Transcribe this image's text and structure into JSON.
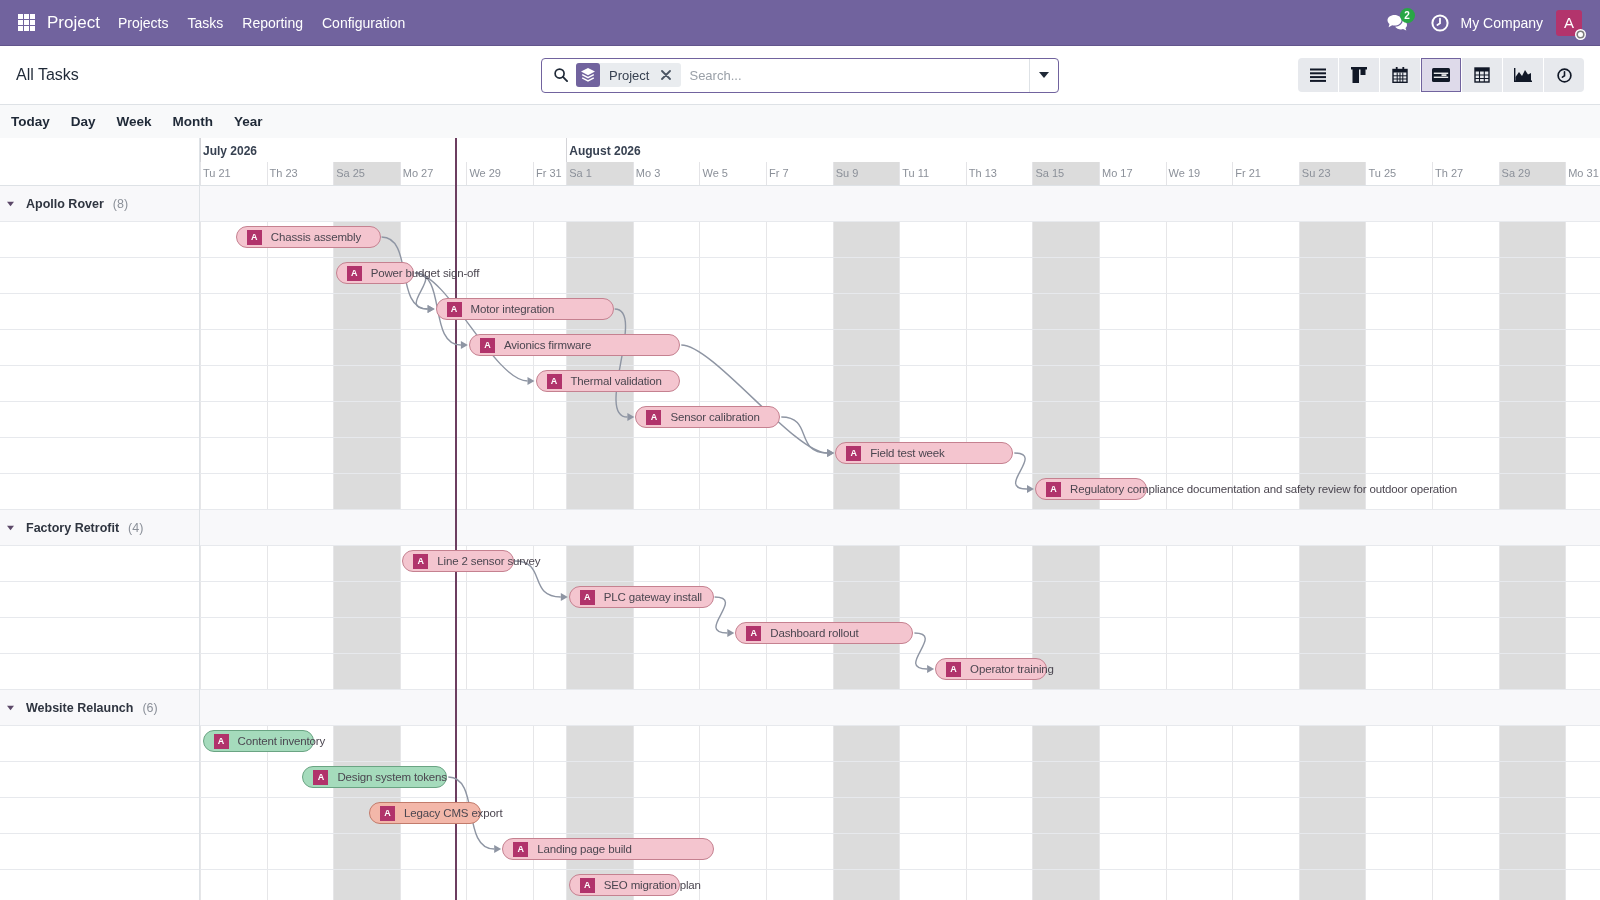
{
  "navbar": {
    "app_name": "Project",
    "menu": [
      "Projects",
      "Tasks",
      "Reporting",
      "Configuration"
    ],
    "message_count": "2",
    "company": "My Company",
    "user_initial": "A"
  },
  "control_panel": {
    "title": "All Tasks",
    "search": {
      "facets": [
        {
          "label": "Project"
        }
      ],
      "placeholder": "Search..."
    },
    "views": [
      {
        "kind": "list",
        "selected": false
      },
      {
        "kind": "kanban",
        "selected": false
      },
      {
        "kind": "calendar",
        "selected": false
      },
      {
        "kind": "gantt",
        "selected": true
      },
      {
        "kind": "pivot",
        "selected": false
      },
      {
        "kind": "graph",
        "selected": false
      },
      {
        "kind": "activity",
        "selected": false
      }
    ]
  },
  "toolbar": [
    "Today",
    "Day",
    "Week",
    "Month",
    "Year"
  ],
  "timeline": {
    "months": [
      {
        "label": "July 2026",
        "columns": [
          {
            "label": "Tu 21",
            "kind": "two_day",
            "weekend": false
          },
          {
            "label": "Th 23",
            "kind": "two_day",
            "weekend": false
          },
          {
            "label": "Sa 25",
            "kind": "two_day",
            "weekend": true
          },
          {
            "label": "Mo 27",
            "kind": "two_day",
            "weekend": false
          },
          {
            "label": "We 29",
            "kind": "two_day",
            "weekend": false
          },
          {
            "label": "Fr 31",
            "kind": "one_day",
            "weekend": false
          }
        ]
      },
      {
        "label": "August 2026",
        "columns": [
          {
            "label": "Sa 1",
            "kind": "two_day",
            "weekend": true
          },
          {
            "label": "Mo 3",
            "kind": "two_day",
            "weekend": false
          },
          {
            "label": "We 5",
            "kind": "two_day",
            "weekend": false
          },
          {
            "label": "Fr 7",
            "kind": "two_day",
            "weekend": false
          },
          {
            "label": "Su 9",
            "kind": "two_day",
            "weekend": true
          },
          {
            "label": "Tu 11",
            "kind": "two_day",
            "weekend": false
          },
          {
            "label": "Th 13",
            "kind": "two_day",
            "weekend": false
          },
          {
            "label": "Sa 15",
            "kind": "two_day",
            "weekend": true
          },
          {
            "label": "Mo 17",
            "kind": "two_day",
            "weekend": false
          },
          {
            "label": "We 19",
            "kind": "two_day",
            "weekend": false
          },
          {
            "label": "Fr 21",
            "kind": "two_day",
            "weekend": false
          },
          {
            "label": "Su 23",
            "kind": "two_day",
            "weekend": true
          },
          {
            "label": "Tu 25",
            "kind": "two_day",
            "weekend": false
          },
          {
            "label": "Th 27",
            "kind": "two_day",
            "weekend": false
          },
          {
            "label": "Sa 29",
            "kind": "two_day",
            "weekend": true
          },
          {
            "label": "Mo 31",
            "kind": "one_day",
            "weekend": false
          }
        ]
      }
    ]
  },
  "groups": [
    {
      "name": "Apollo Rover",
      "count": "(8)",
      "expanded": true,
      "tasks": [
        {
          "name": "Chassis assembly",
          "assignee": "A",
          "color": "#f4c5cf"
        },
        {
          "name": "Power budget sign-off",
          "assignee": "A",
          "color": "#f4c5cf"
        },
        {
          "name": "Motor integration",
          "assignee": "A",
          "color": "#f4c5cf"
        },
        {
          "name": "Avionics firmware",
          "assignee": "A",
          "color": "#f4c5cf"
        },
        {
          "name": "Thermal validation",
          "assignee": "A",
          "color": "#f4c5cf"
        },
        {
          "name": "Sensor calibration",
          "assignee": "A",
          "color": "#f4c5cf"
        },
        {
          "name": "Field test week",
          "assignee": "A",
          "color": "#f4c5cf"
        },
        {
          "name": "Regulatory compliance documentation and safety review for outdoor operation",
          "assignee": "A",
          "color": "#f4c5cf"
        }
      ]
    },
    {
      "name": "Factory Retrofit",
      "count": "(4)",
      "expanded": true,
      "tasks": [
        {
          "name": "Line 2 sensor survey",
          "assignee": "A",
          "color": "#f4c5cf"
        },
        {
          "name": "PLC gateway install",
          "assignee": "A",
          "color": "#f4c5cf"
        },
        {
          "name": "Dashboard rollout",
          "assignee": "A",
          "color": "#f4c5cf"
        },
        {
          "name": "Operator training",
          "assignee": "A",
          "color": "#f4c5cf"
        }
      ]
    },
    {
      "name": "Website Relaunch",
      "count": "(6)",
      "expanded": true,
      "tasks": [
        {
          "name": "Content inventory",
          "assignee": "A",
          "color": "#a5dbbc"
        },
        {
          "name": "Design system tokens",
          "assignee": "A",
          "color": "#a5dbbc"
        },
        {
          "name": "Legacy CMS export",
          "assignee": "A",
          "color": "#f3b7a9"
        },
        {
          "name": "Landing page build",
          "assignee": "A",
          "color": "#f4c5cf"
        },
        {
          "name": "SEO migration plan",
          "assignee": "A",
          "color": "#f4c5cf"
        }
      ]
    }
  ]
}
